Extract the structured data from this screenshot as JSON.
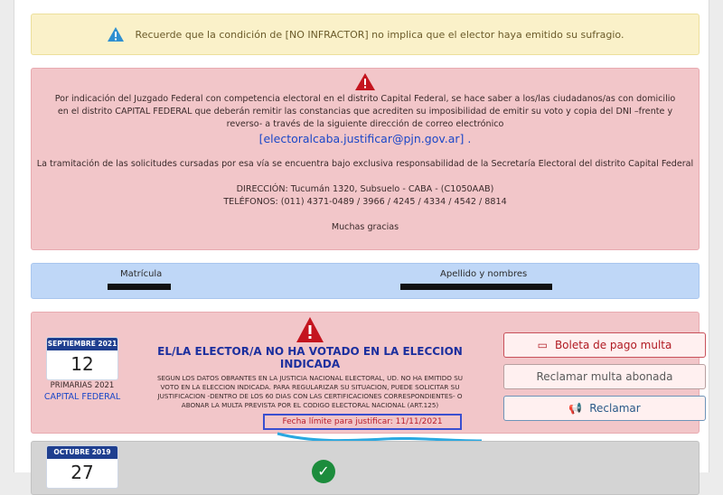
{
  "notice_yellow": {
    "icon": "warning-triangle-icon",
    "text": "Recuerde que la condición de [NO INFRACTOR] no implica que el elector haya emitido su sufragio."
  },
  "notice_red": {
    "icon": "warning-triangle-icon",
    "paragraph": "Por indicación del Juzgado Federal con competencia electoral en el distrito Capital Federal, se hace saber a los/las ciudadanos/as con domicilio en el distrito CAPITAL FEDERAL que deberán remitir las constancias que acrediten su imposibilidad de emitir su voto y copia del DNI –frente y reverso- a través de la siguiente dirección de correo electrónico",
    "email": "[electoralcaba.justificar@pjn.gov.ar] .",
    "responsibility": "La tramitación de las solicitudes cursadas por esa vía se encuentra bajo exclusiva responsabilidad de la Secretaría Electoral del distrito Capital Federal",
    "address": "DIRECCIÓN: Tucumán 1320, Subsuelo - CABA - (C1050AAB)",
    "phones": "TELÉFONOS: (011) 4371-0489 / 3966 / 4245 / 4334 / 4542 / 8814",
    "thanks": "Muchas gracias"
  },
  "elector_info": {
    "label_matricula": "Matrícula",
    "label_nombre": "Apellido y nombres"
  },
  "records": [
    {
      "month": "SEPTIEMBRE 2021",
      "day": "12",
      "election_type": "PRIMARIAS 2021",
      "district": "CAPITAL FEDERAL",
      "title": "EL/LA ELECTOR/A NO HA VOTADO EN LA ELECCION INDICADA",
      "body": "SEGUN LOS DATOS OBRANTES EN LA JUSTICIA NACIONAL ELECTORAL, UD. NO HA EMITIDO SU VOTO EN LA ELECCION INDICADA. PARA REGULARIZAR SU SITUACION, PUEDE SOLICITAR SU JUSTIFICACION -DENTRO DE LOS 60 DIAS CON LAS CERTIFICACIONES CORRESPONDIENTES- O ABONAR LA MULTA PREVISTA POR EL CODIGO ELECTORAL NACIONAL (ART.125)",
      "deadline": "Fecha límite para justificar: 11/11/2021",
      "buttons": {
        "boleta": "Boleta de pago multa",
        "reclamar_multa": "Reclamar multa abonada",
        "reclamar": "Reclamar"
      }
    },
    {
      "month": "OCTUBRE 2019",
      "day": "27"
    }
  ],
  "colors": {
    "alert_yellow": "#faf1c9",
    "alert_red": "#f2c6c9",
    "info_blue": "#bfd7f7",
    "link_blue": "#1b47c8",
    "title_blue": "#1b2f9e",
    "danger_red": "#b01a22"
  }
}
